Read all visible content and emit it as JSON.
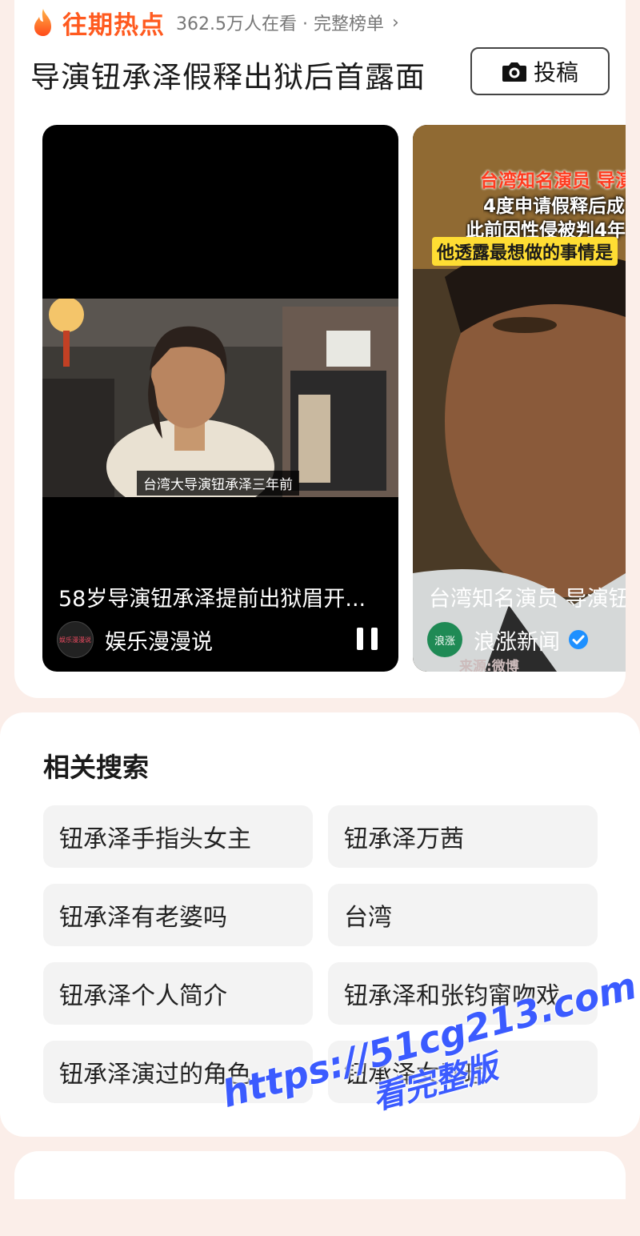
{
  "header": {
    "label": "往期热点",
    "meta": "362.5万人在看 · 完整榜单",
    "chevron": "›",
    "icon": "flame-icon"
  },
  "topic": {
    "title": "导演钮承泽假释出狱后首露面",
    "submit_label": "投稿"
  },
  "videos": [
    {
      "subtitle": "台湾大导演钮承泽三年前",
      "title": "58岁导演钮承泽提前出狱眉开...",
      "author": "娱乐漫漫说",
      "avatar_text": "娱乐漫漫说",
      "state": "playing"
    },
    {
      "overlay_lines": [
        "台湾知名演员 导演",
        "4度申请假释后成",
        "此前因性侵被判4年",
        "他透露最想做的事情是"
      ],
      "title": "台湾知名演员 导演钮",
      "author": "浪涨新闻",
      "avatar_text": "浪涨",
      "verified": true,
      "source": "来源:微博"
    }
  ],
  "related": {
    "title": "相关搜索",
    "items": [
      "钮承泽手指头女主",
      "钮承泽万茜",
      "钮承泽有老婆吗",
      "台湾",
      "钮承泽个人简介",
      "钮承泽和张钧甯吻戏",
      "钮承泽演过的角色",
      "钮承泽女助理"
    ]
  },
  "watermark": {
    "line1": "https://51cg213.com",
    "line2": "看完整版",
    "color": "#3b5bff"
  },
  "colors": {
    "accent": "#ff5a1f",
    "verified": "#1e90ff",
    "page_bg": "#fbeee9"
  }
}
